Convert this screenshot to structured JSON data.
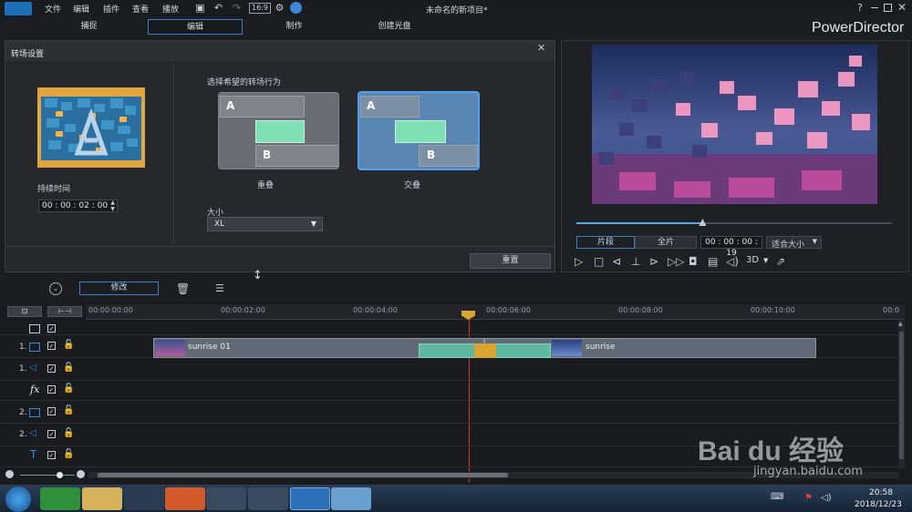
{
  "app": {
    "title": "未命名的新项目*",
    "brand": "PowerDirector",
    "help": "?",
    "menus": [
      "文件",
      "编辑",
      "插件",
      "查看",
      "播放"
    ]
  },
  "mode_tabs": [
    "捕捉",
    "编辑",
    "制作",
    "创建光盘"
  ],
  "active_tab": "编辑",
  "transition": {
    "title": "转场设置",
    "duration_label": "持续时间",
    "duration_value": "00 : 00 : 02 : 00",
    "behavior_label": "选择希望的转场行为",
    "options": [
      {
        "label": "重叠",
        "a": "A",
        "b": "B",
        "selected": false
      },
      {
        "label": "交叠",
        "a": "A",
        "b": "B",
        "selected": true
      }
    ],
    "size_label": "大小",
    "size_value": "XL",
    "reset_label": "重置"
  },
  "preview": {
    "mode_clip": "片段",
    "mode_full": "全片",
    "timecode": "00 : 00 : 00 : 19",
    "fit": "适合大小",
    "threed": "3D",
    "progress": 0.4
  },
  "timeline": {
    "modify_label": "修改",
    "ruler": [
      "00:00:00:00",
      "00:00:02:00",
      "00:00:04:00",
      "00:00:06:00",
      "00:00:08:00",
      "00:00:10:00",
      "00:0"
    ],
    "tracks": [
      {
        "id": "1.",
        "kind": "video"
      },
      {
        "id": "1.",
        "kind": "audio"
      },
      {
        "id": "",
        "kind": "fx",
        "glyph": "fx"
      },
      {
        "id": "2.",
        "kind": "video"
      },
      {
        "id": "2.",
        "kind": "audio"
      },
      {
        "id": "",
        "kind": "title",
        "glyph": "T"
      }
    ],
    "clips": [
      {
        "name": "sunrise 01"
      },
      {
        "name": "sunrise"
      }
    ]
  },
  "taskbar": {
    "time": "20:58",
    "date": "2018/12/23"
  },
  "watermark": {
    "text": "Bai du 经验",
    "url": "jingyan.baidu.com"
  },
  "colors": {
    "accent": "#3d7fc4",
    "clip": "#5f6a75",
    "transition": "#5fb8a0",
    "playhead": "#d23030"
  }
}
